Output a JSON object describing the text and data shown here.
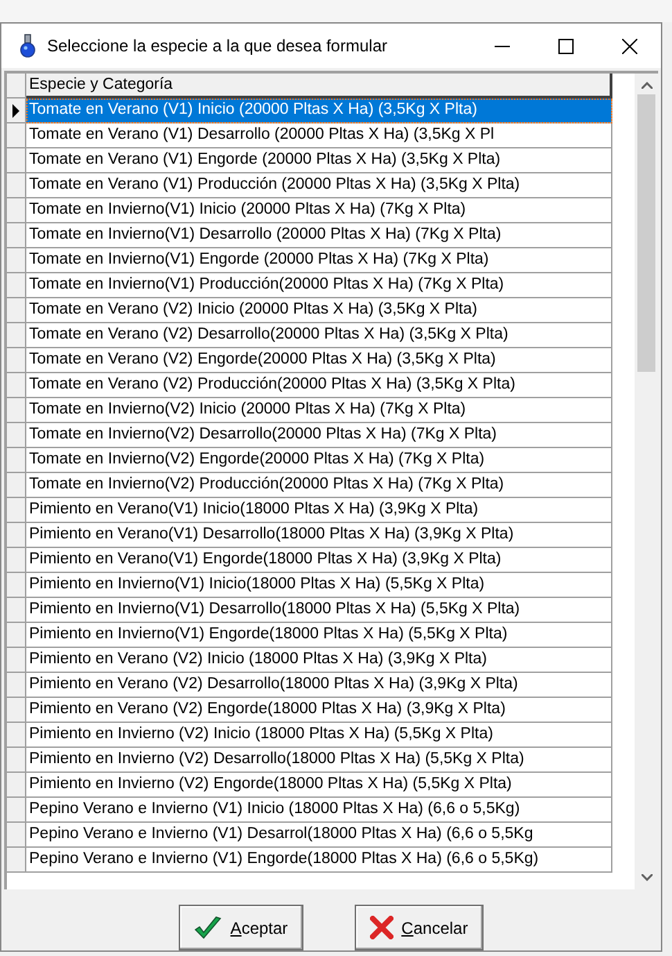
{
  "window": {
    "title": "Seleccione la especie a la que desea formular"
  },
  "grid": {
    "columns": [
      "Especie y Categoría"
    ],
    "rows": [
      {
        "text": "Tomate en Verano (V1) Inicio (20000 Pltas X Ha) (3,5Kg X Plta)",
        "selected": true
      },
      {
        "text": "Tomate en Verano (V1) Desarrollo (20000 Pltas X Ha) (3,5Kg X Pl",
        "selected": false
      },
      {
        "text": "Tomate en Verano (V1) Engorde (20000 Pltas X Ha) (3,5Kg X Plta)",
        "selected": false
      },
      {
        "text": "Tomate en Verano (V1) Producción (20000 Pltas X Ha) (3,5Kg X Plta)",
        "selected": false
      },
      {
        "text": "Tomate en Invierno(V1) Inicio (20000 Pltas X Ha) (7Kg X Plta)",
        "selected": false
      },
      {
        "text": "Tomate en Invierno(V1) Desarrollo (20000 Pltas X Ha) (7Kg X Plta)",
        "selected": false
      },
      {
        "text": "Tomate en Invierno(V1) Engorde (20000 Pltas X Ha) (7Kg X Plta)",
        "selected": false
      },
      {
        "text": "Tomate en Invierno(V1) Producción(20000 Pltas X Ha) (7Kg X Plta)",
        "selected": false
      },
      {
        "text": "Tomate en Verano (V2) Inicio (20000 Pltas X Ha) (3,5Kg X Plta)",
        "selected": false
      },
      {
        "text": "Tomate en Verano (V2) Desarrollo(20000 Pltas X Ha) (3,5Kg X Plta)",
        "selected": false
      },
      {
        "text": "Tomate en Verano (V2) Engorde(20000 Pltas X Ha) (3,5Kg X Plta)",
        "selected": false
      },
      {
        "text": "Tomate en Verano (V2) Producción(20000 Pltas X Ha) (3,5Kg X Plta)",
        "selected": false
      },
      {
        "text": "Tomate en Invierno(V2) Inicio (20000 Pltas X Ha) (7Kg X Plta)",
        "selected": false
      },
      {
        "text": "Tomate en Invierno(V2) Desarrollo(20000 Pltas X Ha) (7Kg X Plta)",
        "selected": false
      },
      {
        "text": "Tomate en Invierno(V2) Engorde(20000 Pltas X Ha) (7Kg X Plta)",
        "selected": false
      },
      {
        "text": "Tomate en Invierno(V2) Producción(20000 Pltas X Ha) (7Kg X Plta)",
        "selected": false
      },
      {
        "text": "Pimiento en Verano(V1) Inicio(18000 Pltas X Ha) (3,9Kg X Plta)",
        "selected": false
      },
      {
        "text": "Pimiento en Verano(V1) Desarrollo(18000 Pltas X Ha) (3,9Kg X Plta)",
        "selected": false
      },
      {
        "text": "Pimiento en Verano(V1) Engorde(18000 Pltas X Ha) (3,9Kg X Plta)",
        "selected": false
      },
      {
        "text": "Pimiento en Invierno(V1) Inicio(18000 Pltas X Ha) (5,5Kg X Plta)",
        "selected": false
      },
      {
        "text": "Pimiento en Invierno(V1) Desarrollo(18000 Pltas X Ha) (5,5Kg X Plta)",
        "selected": false
      },
      {
        "text": "Pimiento en Invierno(V1) Engorde(18000 Pltas X Ha) (5,5Kg X Plta)",
        "selected": false
      },
      {
        "text": "Pimiento en Verano (V2) Inicio (18000 Pltas X Ha) (3,9Kg X Plta)",
        "selected": false
      },
      {
        "text": "Pimiento en Verano (V2) Desarrollo(18000 Pltas X Ha) (3,9Kg X Plta)",
        "selected": false
      },
      {
        "text": "Pimiento en Verano (V2) Engorde(18000 Pltas X Ha) (3,9Kg X Plta)",
        "selected": false
      },
      {
        "text": "Pimiento en Invierno (V2) Inicio (18000 Pltas X Ha) (5,5Kg X Plta)",
        "selected": false
      },
      {
        "text": "Pimiento en Invierno (V2) Desarrollo(18000 Pltas X Ha) (5,5Kg X Plta)",
        "selected": false
      },
      {
        "text": "Pimiento en Invierno (V2) Engorde(18000 Pltas X Ha) (5,5Kg X Plta)",
        "selected": false
      },
      {
        "text": "Pepino Verano e Invierno (V1) Inicio (18000 Pltas X Ha) (6,6 o 5,5Kg)",
        "selected": false
      },
      {
        "text": "Pepino Verano e Invierno (V1) Desarrol(18000 Pltas X Ha) (6,6 o 5,5Kg",
        "selected": false
      },
      {
        "text": "Pepino Verano e Invierno (V1) Engorde(18000 Pltas X Ha) (6,6 o 5,5Kg)",
        "selected": false
      }
    ]
  },
  "buttons": [
    {
      "kind": "ok",
      "label": "Aceptar"
    },
    {
      "kind": "cancel",
      "label": "Cancelar"
    }
  ]
}
